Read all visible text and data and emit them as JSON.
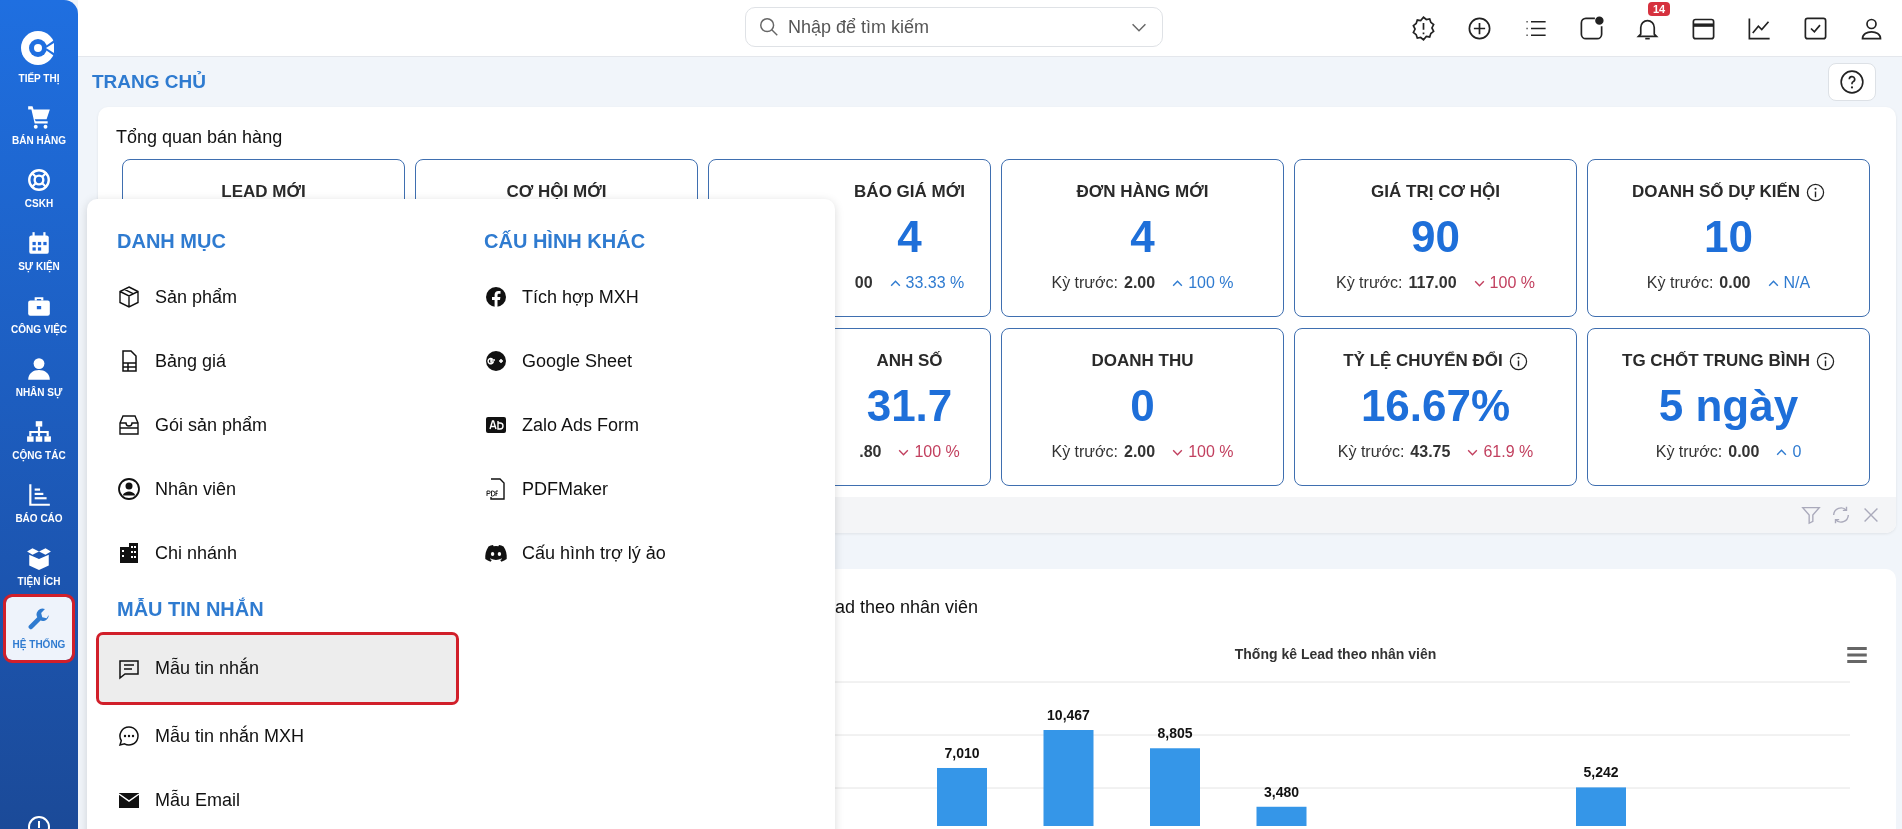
{
  "sidebar": {
    "items": [
      {
        "label": "TIẾP THỊ",
        "selected": false
      },
      {
        "label": "BÁN HÀNG",
        "selected": false
      },
      {
        "label": "CSKH",
        "selected": false
      },
      {
        "label": "SỰ KIỆN",
        "selected": false
      },
      {
        "label": "CÔNG VIỆC",
        "selected": false
      },
      {
        "label": "NHÂN SỰ",
        "selected": false
      },
      {
        "label": "CỘNG TÁC",
        "selected": false
      },
      {
        "label": "BÁO CÁO",
        "selected": false
      },
      {
        "label": "TIỆN ÍCH",
        "selected": false
      },
      {
        "label": "HỆ THỐNG",
        "selected": true
      }
    ]
  },
  "topbar": {
    "search": {
      "placeholder": "Nhập để tìm kiếm"
    },
    "notification_count": "14"
  },
  "page": {
    "title": "TRANG CHỦ"
  },
  "overview": {
    "title": "Tổng quan bán hàng",
    "rows": [
      [
        {
          "label": "LEAD MỚI",
          "info": false,
          "partial": false
        },
        {
          "label": "CƠ HỘI MỚI",
          "info": false,
          "partial": false
        },
        {
          "label": "BÁO GIÁ MỚI",
          "info": false,
          "partial": true,
          "value": "4",
          "prev_value": "00",
          "rising": true,
          "delta": "33.33 %"
        },
        {
          "label": "ĐƠN HÀNG MỚI",
          "info": false,
          "partial": false,
          "value": "4",
          "prev_label": "Kỳ trước:",
          "prev_value": "2.00",
          "rising": true,
          "delta": "100 %"
        },
        {
          "label": "GIÁ TRỊ CƠ HỘI",
          "info": false,
          "partial": false,
          "value": "90",
          "prev_label": "Kỳ trước:",
          "prev_value": "117.00",
          "rising": false,
          "delta": "100 %"
        },
        {
          "label": "DOANH SỐ DỰ KIẾN",
          "info": true,
          "partial": false,
          "value": "10",
          "prev_label": "Kỳ trước:",
          "prev_value": "0.00",
          "rising": true,
          "delta": "N/A"
        }
      ],
      [
        "",
        "",
        {
          "label": "ANH SỐ",
          "info": false,
          "partial": true,
          "value": "31.7",
          "prev_value": ".80",
          "rising": false,
          "delta": "100 %"
        },
        {
          "label": "DOANH THU",
          "info": false,
          "partial": false,
          "value": "0",
          "prev_label": "Kỳ trước:",
          "prev_value": "2.00",
          "rising": false,
          "delta": "100 %"
        },
        {
          "label": "TỶ LỆ CHUYỂN ĐỔI",
          "info": true,
          "partial": false,
          "value": "16.67%",
          "prev_label": "Kỳ trước:",
          "prev_value": "43.75",
          "rising": false,
          "delta": "61.9 %"
        },
        {
          "label": "TG CHỐT TRUNG BÌNH",
          "info": true,
          "partial": false,
          "value": "5 ngày",
          "prev_label": "Kỳ trước:",
          "prev_value": "0.00",
          "rising": true,
          "delta": "0"
        }
      ]
    ]
  },
  "lead_card": {
    "title": "ad theo nhân viên",
    "chart_title": "Thống kê Lead theo nhân viên",
    "bar_labels": [
      "7,010",
      "10,467",
      "8,805",
      "3,480",
      "5,242"
    ]
  },
  "menu": {
    "columns": [
      [
        {
          "title": "DANH MỤC",
          "items": [
            {
              "label": "Sản phẩm",
              "selected": false
            },
            {
              "label": "Bảng giá",
              "selected": false
            },
            {
              "label": "Gói sản phẩm",
              "selected": false
            },
            {
              "label": "Nhân viên",
              "selected": false
            },
            {
              "label": "Chi nhánh",
              "selected": false
            }
          ]
        },
        {
          "title": "MẪU TIN NHẮN",
          "items": [
            {
              "label": "Mẫu tin nhắn",
              "selected": true
            },
            {
              "label": "Mẫu tin nhắn MXH",
              "selected": false
            },
            {
              "label": "Mẫu Email",
              "selected": false
            }
          ]
        }
      ],
      [
        {
          "title": "CẤU HÌNH KHÁC",
          "items": [
            {
              "label": "Tích hợp MXH",
              "selected": false
            },
            {
              "label": "Google Sheet",
              "selected": false
            },
            {
              "label": "Zalo Ads Form",
              "selected": false
            },
            {
              "label": "PDFMaker",
              "selected": false
            },
            {
              "label": "Cấu hình trợ lý ảo",
              "selected": false
            }
          ]
        }
      ]
    ]
  }
}
